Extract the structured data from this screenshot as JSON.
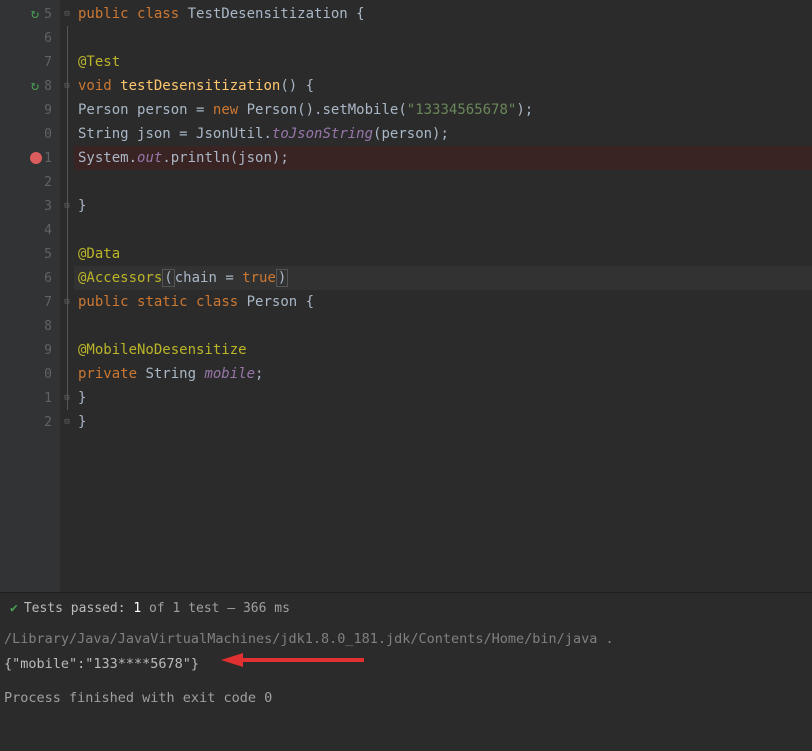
{
  "line_numbers": [
    "5",
    "6",
    "7",
    "8",
    "9",
    "0",
    "1",
    "2",
    "3",
    "4",
    "5",
    "6",
    "7",
    "8",
    "9",
    "0",
    "1",
    "2"
  ],
  "code": {
    "l15": {
      "kw1": "public ",
      "kw2": "class ",
      "cls": "TestDesensitization ",
      "brace": "{"
    },
    "l17": {
      "ann": "@Test"
    },
    "l18": {
      "kw": "void ",
      "mth": "testDesensitization",
      "sig": "() {"
    },
    "l19": {
      "t1": "Person ",
      "v": "person ",
      "eq": "= ",
      "kw": "new ",
      "ctor": "Person().setMobile(",
      "str": "\"13334565678\"",
      "end": ");"
    },
    "l20": {
      "t1": "String ",
      "v": "json ",
      "eq": "= JsonUtil.",
      "mth": "toJsonString",
      "end": "(person);"
    },
    "l21": {
      "t1": "System.",
      "out": "out",
      "t2": ".println(json);"
    },
    "l23": {
      "brace": "}"
    },
    "l25": {
      "ann": "@Data"
    },
    "l26": {
      "ann": "@Accessors",
      "open": "(",
      "p": "chain ",
      "eq": "= ",
      "kw": "true",
      "close": ")"
    },
    "l27": {
      "kw1": "public ",
      "kw2": "static ",
      "kw3": "class ",
      "cls": "Person ",
      "brace": "{"
    },
    "l29": {
      "ann": "@MobileNoDesensitize"
    },
    "l30": {
      "kw": "private ",
      "t": "String ",
      "v": "mobile",
      ";": ";"
    },
    "l31": {
      "brace": "}"
    },
    "l32": {
      "brace": "}"
    }
  },
  "tests": {
    "label": "Tests passed:",
    "count": "1",
    "of": " of 1 test – 366 ms"
  },
  "console": {
    "cmd": "/Library/Java/JavaVirtualMachines/jdk1.8.0_181.jdk/Contents/Home/bin/java  .",
    "json": "{\"mobile\":\"133****5678\"}",
    "exit": "Process finished with exit code 0"
  }
}
